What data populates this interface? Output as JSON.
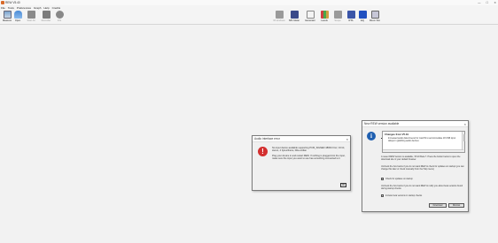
{
  "window": {
    "title": "REW V5.40",
    "buttons": [
      "—",
      "☐",
      "✕"
    ]
  },
  "menubar": {
    "items": [
      "File",
      "Tools",
      "Preferences",
      "Graph",
      "Help",
      "Credits"
    ]
  },
  "toolbar": {
    "left": [
      {
        "name": "measure",
        "label": "Measure",
        "icon": "monitor-icon",
        "disabled": false
      },
      {
        "name": "open",
        "label": "Open",
        "icon": "open-folder-icon",
        "disabled": false
      },
      {
        "name": "start-all",
        "label": "Start All",
        "icon": "start-icon",
        "disabled": true
      },
      {
        "name": "recorder",
        "label": "Recorder",
        "icon": "recorder-icon",
        "disabled": true
      },
      {
        "name": "info",
        "label": "Info",
        "icon": "info-icon",
        "disabled": true
      }
    ],
    "right": [
      {
        "name": "ir-windows",
        "label": "IR windows",
        "icon": "ir-windows-icon",
        "disabled": true
      },
      {
        "name": "spl-meter",
        "label": "SPL Meter",
        "icon": "spl-meter-icon",
        "disabled": false
      },
      {
        "name": "generator",
        "label": "Generator",
        "icon": "generator-icon",
        "disabled": false
      },
      {
        "name": "levels",
        "label": "Levels",
        "icon": "levels-icon",
        "disabled": false
      },
      {
        "name": "scope",
        "label": "Scope",
        "icon": "scope-icon",
        "disabled": true
      },
      {
        "name": "rta",
        "label": "RTA",
        "icon": "rta-icon",
        "disabled": false
      },
      {
        "name": "eq",
        "label": "EQ",
        "icon": "eq-icon",
        "disabled": false
      },
      {
        "name": "room-sim",
        "label": "Room Sim",
        "icon": "room-sim-icon",
        "disabled": false
      }
    ]
  },
  "audio_dialog": {
    "title": "Audio interface error",
    "message_1": "No input device available supporting PCM_SIGNED 48000.0 Hz, 16 bit, stereo, 4 bytes/frame, little-endian",
    "message_2": "Plug your device in and restart REW. If nothing is plugged into the input, make sure the input you want to use has something connected to it",
    "ok_label": "OK"
  },
  "update_dialog": {
    "title": "New REW version available",
    "changes_title": "Changes from V5.19",
    "changes": [
      "Increased audio data timeout for macOS to accommodate 18 USB input delays in grabbing audio devices"
    ],
    "text_1": "A newer REW Version is available, V5.20 Beta 7. Press the button below to open the download site in your default browser.",
    "text_2": "Uncheck the box below if you do not want REW to check for updates on startup (you can change this later or check manually from the Help menu)",
    "check_updates_label": "Check for updates on startup",
    "text_3": "Uncheck the box below if you do not want REW to notify you about beta versions found during startup checks",
    "include_beta_label": "Include beta versions in startup checks",
    "download_label": "Download",
    "dismiss_label": "Dismiss"
  }
}
